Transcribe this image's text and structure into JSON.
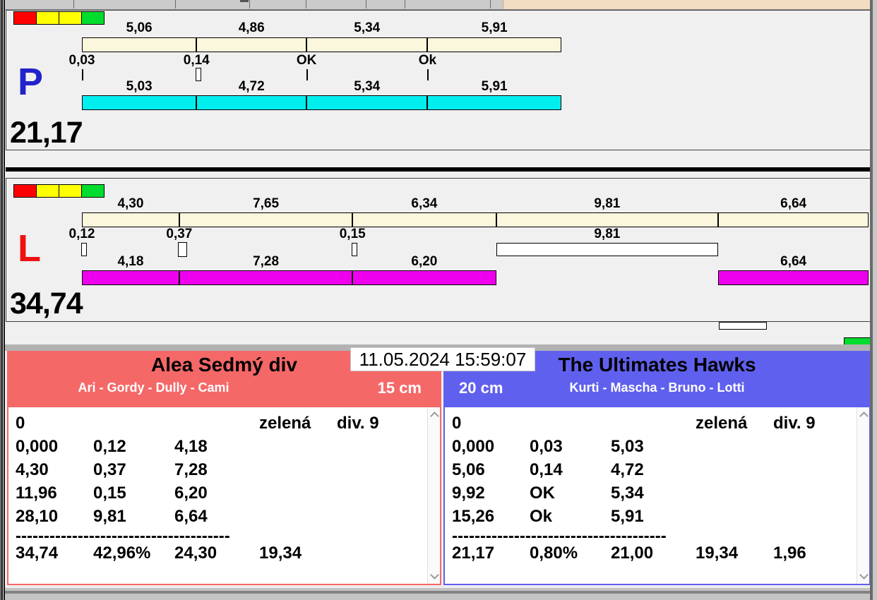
{
  "colors": {
    "background": "#f0f0f0",
    "cream_bar": "#faf7dc",
    "cyan_bar": "#00eeee",
    "magenta_bar": "#ee00ee",
    "team_left": "#f56868",
    "team_right": "#6060ee",
    "letter_p": "#2222cc",
    "letter_l": "#ee1111",
    "green_indicator": "#00dd2e",
    "light_red": "#ff0000",
    "light_yellow": "#ffff00",
    "light_green": "#00dd2e"
  },
  "timestamp": "11.05.2024 15:59:07",
  "panels": {
    "p": {
      "letter": "P",
      "total": "21,17",
      "lights": [
        "#ff0000",
        "#ffff00",
        "#ffff00",
        "#00dd2e"
      ],
      "top_segments": [
        {
          "label": "5,06",
          "value": 5.06
        },
        {
          "label": "4,86",
          "value": 4.86
        },
        {
          "label": "5,34",
          "value": 5.34
        },
        {
          "label": "5,91",
          "value": 5.91
        }
      ],
      "markers": [
        {
          "label": "0,03",
          "slot": 0,
          "type": "tick"
        },
        {
          "label": "0,14",
          "slot": 1,
          "type": "box-narrow"
        },
        {
          "label": "OK",
          "slot": 2,
          "type": "tick"
        },
        {
          "label": "Ok",
          "slot": 3,
          "type": "tick"
        }
      ],
      "bottom_color": "#00eeee",
      "bottom_segments": [
        {
          "label": "5,03",
          "slot": 0
        },
        {
          "label": "4,72",
          "slot": 1
        },
        {
          "label": "5,34",
          "slot": 2
        },
        {
          "label": "5,91",
          "slot": 3
        }
      ]
    },
    "l": {
      "letter": "L",
      "total": "34,74",
      "lights": [
        "#ff0000",
        "#ffff00",
        "#ffff00",
        "#00dd2e"
      ],
      "top_segments": [
        {
          "label": "4,30",
          "value": 4.3
        },
        {
          "label": "7,65",
          "value": 7.65
        },
        {
          "label": "6,34",
          "value": 6.34
        },
        {
          "label": "9,81",
          "value": 9.81
        },
        {
          "label": "6,64",
          "value": 6.64
        }
      ],
      "markers": [
        {
          "label": "0,12",
          "slot": 0,
          "type": "box-narrow"
        },
        {
          "label": "0,37",
          "slot": 1,
          "type": "box-wide"
        },
        {
          "label": "0,15",
          "slot": 2,
          "type": "box-narrow"
        }
      ],
      "pending": {
        "label": "9,81",
        "slot": 3
      },
      "bottom_color": "#ee00ee",
      "bottom_segments": [
        {
          "label": "4,18",
          "slot": 0
        },
        {
          "label": "7,28",
          "slot": 1
        },
        {
          "label": "6,20",
          "slot": 2
        },
        {
          "label": "6,64",
          "slot": 4
        }
      ]
    }
  },
  "teams": {
    "left": {
      "name": "Alea Sedmý div",
      "players": "Ari - Gordy - Dully - Cami",
      "distance": "15 cm"
    },
    "right": {
      "name": "The Ultimates Hawks",
      "players": "Kurti - Mascha - Bruno - Lotti",
      "distance": "20 cm"
    }
  },
  "tables": {
    "left": {
      "rows": [
        [
          "0",
          "",
          "",
          "zelená",
          "div. 9"
        ],
        [
          "0,000",
          "0,12",
          "4,18",
          "",
          ""
        ],
        [
          "4,30",
          "0,37",
          "7,28",
          "",
          ""
        ],
        [
          "11,96",
          "0,15",
          "6,20",
          "",
          ""
        ],
        [
          "28,10",
          "9,81",
          "6,64",
          "",
          ""
        ],
        [
          "--------------------------------------",
          "",
          "",
          "",
          ""
        ],
        [
          "34,74",
          "42,96%",
          "24,30",
          "19,34",
          ""
        ]
      ]
    },
    "right": {
      "rows": [
        [
          "0",
          "",
          "",
          "zelená",
          "div. 9"
        ],
        [
          "0,000",
          "0,03",
          "5,03",
          "",
          ""
        ],
        [
          "5,06",
          "0,14",
          "4,72",
          "",
          ""
        ],
        [
          "9,92",
          "OK",
          "5,34",
          "",
          ""
        ],
        [
          "15,26",
          "Ok",
          "5,91",
          "",
          ""
        ],
        [
          "--------------------------------------",
          "",
          "",
          "",
          ""
        ],
        [
          "21,17",
          "0,80%",
          "21,00",
          "19,34",
          "1,96"
        ]
      ]
    }
  }
}
